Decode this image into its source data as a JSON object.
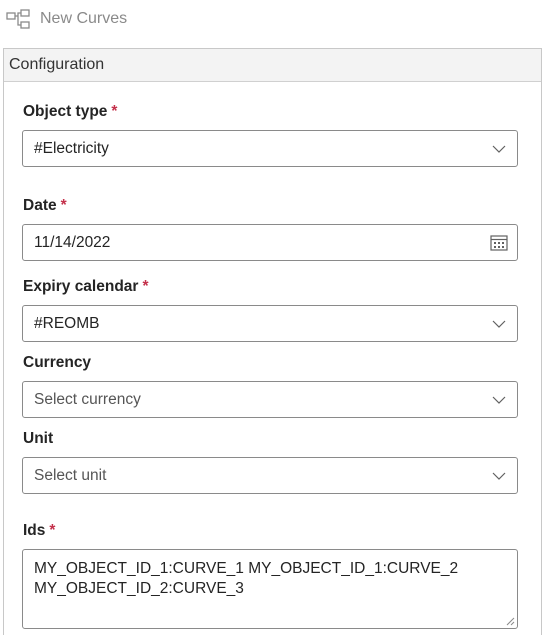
{
  "header": {
    "title": "New Curves",
    "icon": "workflow-icon"
  },
  "panel": {
    "title": "Configuration"
  },
  "fields": {
    "object_type": {
      "label": "Object type",
      "required_mark": "*",
      "value": "#Electricity"
    },
    "date": {
      "label": "Date",
      "required_mark": "*",
      "value": "11/14/2022"
    },
    "expiry_calendar": {
      "label": "Expiry calendar",
      "required_mark": "*",
      "value": "#REOMB"
    },
    "currency": {
      "label": "Currency",
      "placeholder": "Select currency"
    },
    "unit": {
      "label": "Unit",
      "placeholder": "Select unit"
    },
    "ids": {
      "label": "Ids",
      "required_mark": "*",
      "lines": [
        "MY_OBJECT_ID_1:CURVE_1 MY_OBJECT_ID_1:CURVE_2",
        "MY_OBJECT_ID_2:CURVE_3"
      ]
    }
  },
  "colors": {
    "required": "#c4314b",
    "border": "#8a8a8a",
    "panel_header_bg": "#f3f3f3"
  }
}
